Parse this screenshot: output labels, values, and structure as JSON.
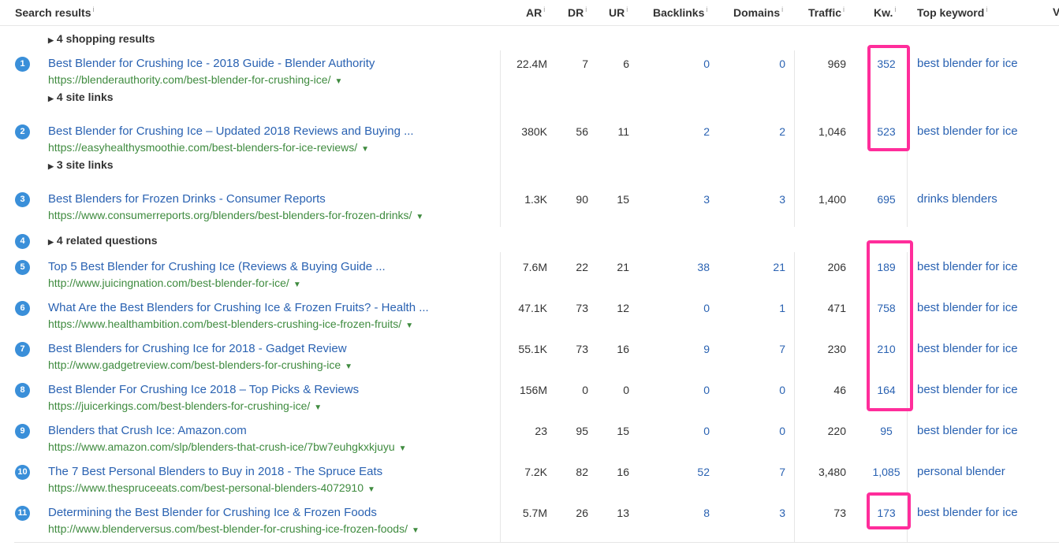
{
  "header": {
    "search_results": "Search results",
    "ar": "AR",
    "dr": "DR",
    "ur": "UR",
    "backlinks": "Backlinks",
    "domains": "Domains",
    "traffic": "Traffic",
    "kw": "Kw.",
    "top_keyword": "Top keyword",
    "info_mark": "i",
    "cut_column": "V"
  },
  "groups": {
    "shopping": "4 shopping results",
    "site_links_1": "4 site links",
    "site_links_2": "3 site links",
    "related": "4 related questions"
  },
  "position_4": "4",
  "results": [
    {
      "n": "1",
      "title": "Best Blender for Crushing Ice - 2018 Guide - Blender Authority",
      "url": "https://blenderauthority.com/best-blender-for-crushing-ice/",
      "ar": "22.4M",
      "dr": "7",
      "ur": "6",
      "backlinks": "0",
      "domains": "0",
      "traffic": "969",
      "kw": "352",
      "top_keyword": "best blender for ice"
    },
    {
      "n": "2",
      "title": "Best Blender for Crushing Ice – Updated 2018 Reviews and Buying ...",
      "url": "https://easyhealthysmoothie.com/best-blenders-for-ice-reviews/",
      "ar": "380K",
      "dr": "56",
      "ur": "11",
      "backlinks": "2",
      "domains": "2",
      "traffic": "1,046",
      "kw": "523",
      "top_keyword": "best blender for ice"
    },
    {
      "n": "3",
      "title": "Best Blenders for Frozen Drinks - Consumer Reports",
      "url": "https://www.consumerreports.org/blenders/best-blenders-for-frozen-drinks/",
      "ar": "1.3K",
      "dr": "90",
      "ur": "15",
      "backlinks": "3",
      "domains": "3",
      "traffic": "1,400",
      "kw": "695",
      "top_keyword": "drinks blenders"
    },
    {
      "n": "5",
      "title": "Top 5 Best Blender for Crushing Ice (Reviews & Buying Guide ...",
      "url": "http://www.juicingnation.com/best-blender-for-ice/",
      "ar": "7.6M",
      "dr": "22",
      "ur": "21",
      "backlinks": "38",
      "domains": "21",
      "traffic": "206",
      "kw": "189",
      "top_keyword": "best blender for ice"
    },
    {
      "n": "6",
      "title": "What Are the Best Blenders for Crushing Ice & Frozen Fruits? - Health ...",
      "url": "https://www.healthambition.com/best-blenders-crushing-ice-frozen-fruits/",
      "ar": "47.1K",
      "dr": "73",
      "ur": "12",
      "backlinks": "0",
      "domains": "1",
      "traffic": "471",
      "kw": "758",
      "top_keyword": "best blender for ice"
    },
    {
      "n": "7",
      "title": "Best Blenders for Crushing Ice for 2018 - Gadget Review",
      "url": "http://www.gadgetreview.com/best-blenders-for-crushing-ice",
      "ar": "55.1K",
      "dr": "73",
      "ur": "16",
      "backlinks": "9",
      "domains": "7",
      "traffic": "230",
      "kw": "210",
      "top_keyword": "best blender for ice"
    },
    {
      "n": "8",
      "title": "Best Blender For Crushing Ice 2018 – Top Picks & Reviews",
      "url": "https://juicerkings.com/best-blenders-for-crushing-ice/",
      "ar": "156M",
      "dr": "0",
      "ur": "0",
      "backlinks": "0",
      "domains": "0",
      "traffic": "46",
      "kw": "164",
      "top_keyword": "best blender for ice"
    },
    {
      "n": "9",
      "title": "Blenders that Crush Ice: Amazon.com",
      "url": "https://www.amazon.com/slp/blenders-that-crush-ice/7bw7euhgkxkjuyu",
      "ar": "23",
      "dr": "95",
      "ur": "15",
      "backlinks": "0",
      "domains": "0",
      "traffic": "220",
      "kw": "95",
      "top_keyword": "best blender for ice"
    },
    {
      "n": "10",
      "title": "The 7 Best Personal Blenders to Buy in 2018 - The Spruce Eats",
      "url": "https://www.thespruceeats.com/best-personal-blenders-4072910",
      "ar": "7.2K",
      "dr": "82",
      "ur": "16",
      "backlinks": "52",
      "domains": "7",
      "traffic": "3,480",
      "kw": "1,085",
      "top_keyword": "personal blender"
    },
    {
      "n": "11",
      "title": "Determining the Best Blender for Crushing Ice & Frozen Foods",
      "url": "http://www.blenderversus.com/best-blender-for-crushing-ice-frozen-foods/",
      "ar": "5.7M",
      "dr": "26",
      "ur": "13",
      "backlinks": "8",
      "domains": "3",
      "traffic": "73",
      "kw": "173",
      "top_keyword": "best blender for ice"
    }
  ],
  "colors": {
    "link": "#2a62b2",
    "url": "#3f8b3f",
    "badge": "#3a8fd9",
    "highlight": "#ff2d9b"
  }
}
